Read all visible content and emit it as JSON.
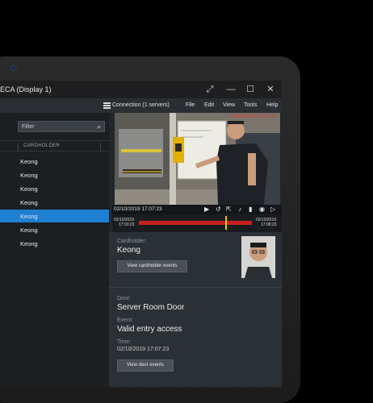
{
  "window": {
    "title": "ECA (Display 1)",
    "buttons": [
      "⤢",
      "—",
      "☐",
      "✕"
    ]
  },
  "menubar": {
    "connection": "Connection (1 servers)",
    "items": [
      "File",
      "Edit",
      "View",
      "Tools",
      "Help"
    ]
  },
  "sidebar": {
    "filter_placeholder": "Filter",
    "column_header": "CARDHOLDER",
    "rows": [
      "Keong",
      "Keong",
      "Keong",
      "Keong",
      "Keong",
      "Keong",
      "Keong"
    ],
    "selected_index": 4
  },
  "video": {
    "overlay_timestamp": "02/10/2019 17:07:24",
    "datetime_date": "02/10/2019",
    "datetime_time": "17:07:23",
    "timeline_start_date": "02/10/2019",
    "timeline_start_time": "17:03:23",
    "timeline_end_date": "02/10/2019",
    "timeline_end_time": "17:08:23"
  },
  "details": {
    "cardholder_label": "Cardholder:",
    "cardholder_name": "Keong",
    "view_cardholder_events": "View cardholder events",
    "door_label": "Door:",
    "door_name": "Server Room Door",
    "event_label": "Event:",
    "event_name": "Valid entry access",
    "time_label": "Time:",
    "time_value": "02/10/2019 17:07:23",
    "view_door_events": "View door events"
  },
  "colors": {
    "accent": "#1f7fd1",
    "timeline_red": "#c82020",
    "cursor_yellow": "#f2c200"
  }
}
